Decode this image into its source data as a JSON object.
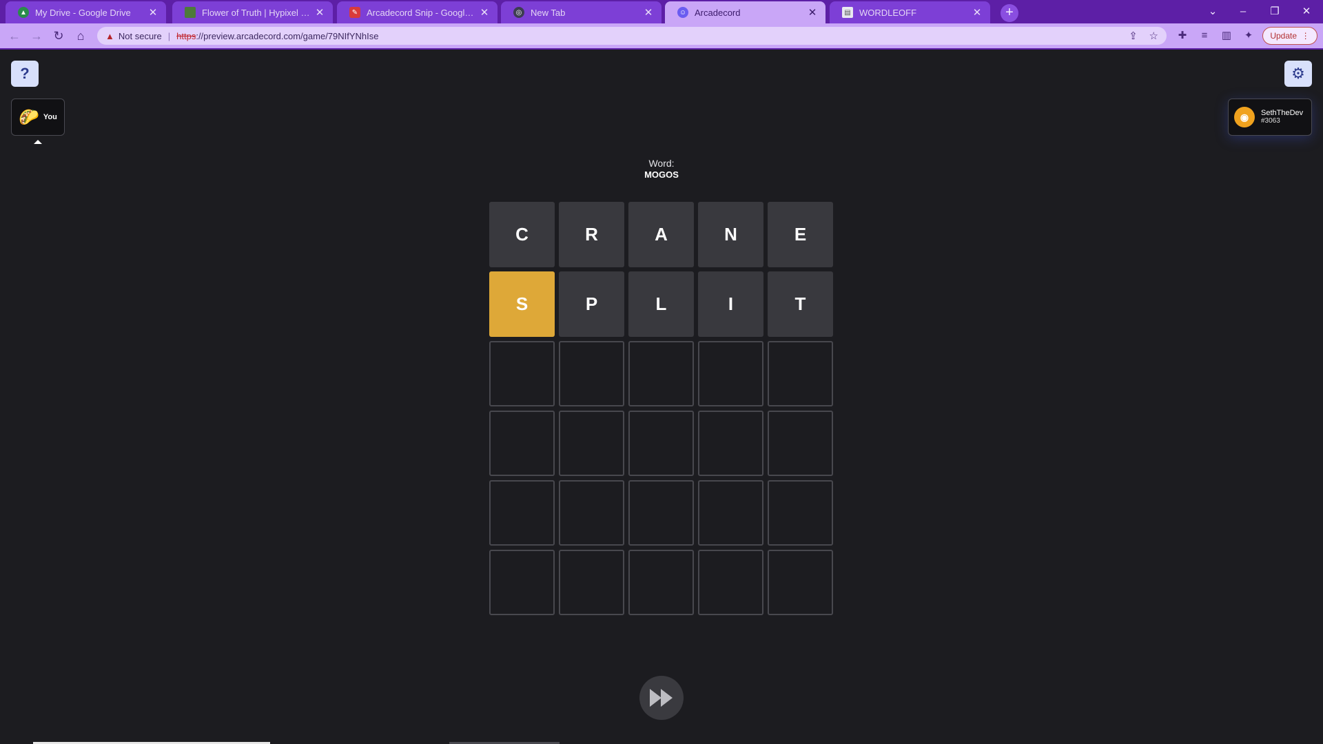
{
  "browser": {
    "tabs": [
      {
        "title": "My Drive - Google Drive",
        "icon": "google-drive-icon",
        "active": false
      },
      {
        "title": "Flower of Truth | Hypixel SkyBlock",
        "icon": "minecraft-block-icon",
        "active": false
      },
      {
        "title": "Arcadecord Snip - Google Drawings",
        "icon": "google-drawings-icon",
        "active": false
      },
      {
        "title": "New Tab",
        "icon": "chrome-icon",
        "active": false
      },
      {
        "title": "Arcadecord",
        "icon": "arcadecord-icon",
        "active": true
      },
      {
        "title": "WORDLEOFF",
        "icon": "document-icon",
        "active": false
      }
    ],
    "address": {
      "security_label": "Not secure",
      "url_scheme": "https",
      "url_rest": "://preview.arcadecord.com/game/79NIfYNhIse"
    },
    "update_label": "Update"
  },
  "game": {
    "help_label": "?",
    "player_label": "You",
    "opponent": {
      "name": "SethTheDev",
      "tag": "#3063"
    },
    "word_label": "Word:",
    "word_value": "MOGOS",
    "colors": {
      "absent": "#39393e",
      "present": "#dea838",
      "empty_border": "#48484e"
    },
    "board": [
      [
        {
          "letter": "C",
          "state": "absent"
        },
        {
          "letter": "R",
          "state": "absent"
        },
        {
          "letter": "A",
          "state": "absent"
        },
        {
          "letter": "N",
          "state": "absent"
        },
        {
          "letter": "E",
          "state": "absent"
        }
      ],
      [
        {
          "letter": "S",
          "state": "present"
        },
        {
          "letter": "P",
          "state": "absent"
        },
        {
          "letter": "L",
          "state": "absent"
        },
        {
          "letter": "I",
          "state": "absent"
        },
        {
          "letter": "T",
          "state": "absent"
        }
      ],
      [
        {
          "letter": "",
          "state": "empty"
        },
        {
          "letter": "",
          "state": "empty"
        },
        {
          "letter": "",
          "state": "empty"
        },
        {
          "letter": "",
          "state": "empty"
        },
        {
          "letter": "",
          "state": "empty"
        }
      ],
      [
        {
          "letter": "",
          "state": "empty"
        },
        {
          "letter": "",
          "state": "empty"
        },
        {
          "letter": "",
          "state": "empty"
        },
        {
          "letter": "",
          "state": "empty"
        },
        {
          "letter": "",
          "state": "empty"
        }
      ],
      [
        {
          "letter": "",
          "state": "empty"
        },
        {
          "letter": "",
          "state": "empty"
        },
        {
          "letter": "",
          "state": "empty"
        },
        {
          "letter": "",
          "state": "empty"
        },
        {
          "letter": "",
          "state": "empty"
        }
      ],
      [
        {
          "letter": "",
          "state": "empty"
        },
        {
          "letter": "",
          "state": "empty"
        },
        {
          "letter": "",
          "state": "empty"
        },
        {
          "letter": "",
          "state": "empty"
        },
        {
          "letter": "",
          "state": "empty"
        }
      ]
    ]
  }
}
